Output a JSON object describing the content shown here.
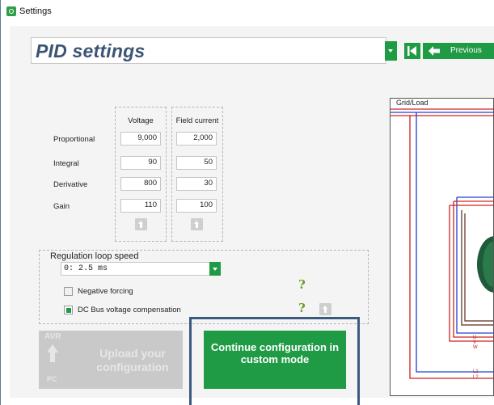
{
  "window": {
    "title": "Settings"
  },
  "header": {
    "page_title": "PID settings",
    "previous_label": "Previous"
  },
  "pid": {
    "columns": [
      "Voltage",
      "Field current"
    ],
    "rows": [
      {
        "label": "Proportional",
        "voltage": "9,000",
        "field_current": "2,000"
      },
      {
        "label": "Integral",
        "voltage": "90",
        "field_current": "50"
      },
      {
        "label": "Derivative",
        "voltage": "800",
        "field_current": "30"
      },
      {
        "label": "Gain",
        "voltage": "110",
        "field_current": "100"
      }
    ]
  },
  "regulation": {
    "label": "Regulation loop speed",
    "selected": "0: 2.5 ms"
  },
  "options": {
    "negative_forcing": {
      "label": "Negative forcing",
      "checked": false
    },
    "dc_bus": {
      "label": "DC Bus voltage compensation",
      "checked": true
    },
    "help_glyph": "?"
  },
  "actions": {
    "avr_top": "AVR",
    "avr_bottom": "PC",
    "upload_label": "Upload your configuration",
    "continue_label": "Continue configuration in custom mode"
  },
  "diagram": {
    "title": "Grid/Load",
    "phase_labels": [
      "U",
      "V",
      "W"
    ],
    "line_labels": [
      "L1",
      "L2"
    ]
  },
  "colors": {
    "accent": "#1f9a45",
    "title": "#3a5573",
    "highlight": "#3c5a7d"
  }
}
